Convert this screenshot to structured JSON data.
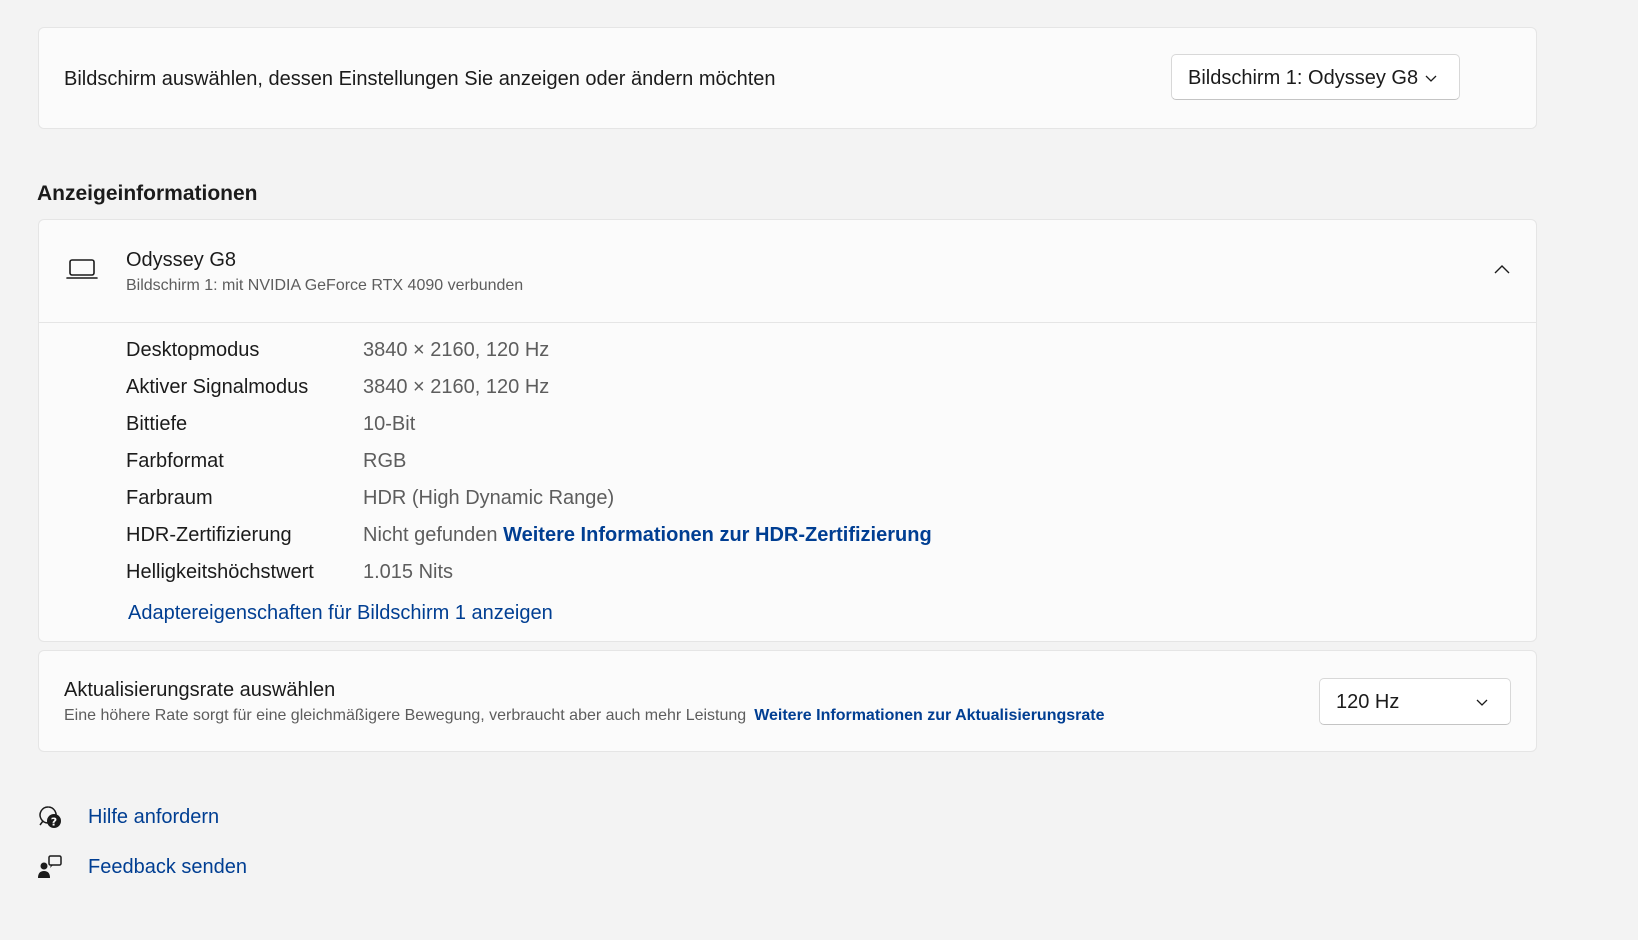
{
  "display_select": {
    "label": "Bildschirm auswählen, dessen Einstellungen Sie anzeigen oder ändern möchten",
    "selected": "Bildschirm 1: Odyssey G8"
  },
  "section_title": "Anzeigeinformationen",
  "monitor": {
    "name": "Odyssey G8",
    "subtitle": "Bildschirm 1: mit NVIDIA GeForce RTX 4090 verbunden",
    "icon": "monitor-icon",
    "rows": [
      {
        "label": "Desktopmodus",
        "value": "3840 × 2160, 120 Hz"
      },
      {
        "label": "Aktiver Signalmodus",
        "value": "3840 × 2160, 120 Hz"
      },
      {
        "label": "Bittiefe",
        "value": "10-Bit"
      },
      {
        "label": "Farbformat",
        "value": "RGB"
      },
      {
        "label": "Farbraum",
        "value": "HDR (High Dynamic Range)"
      },
      {
        "label": "HDR-Zertifizierung",
        "value": "Nicht gefunden",
        "link": "Weitere Informationen zur HDR-Zertifizierung"
      },
      {
        "label": "Helligkeitshöchstwert",
        "value": "1.015 Nits"
      }
    ],
    "adapter_link": "Adaptereigenschaften für Bildschirm 1 anzeigen"
  },
  "refresh_rate": {
    "title": "Aktualisierungsrate auswählen",
    "description": "Eine höhere Rate sorgt für eine gleichmäßigere Bewegung, verbraucht aber auch mehr Leistung",
    "link": "Weitere Informationen zur Aktualisierungsrate",
    "selected": "120 Hz"
  },
  "footer": {
    "help": "Hilfe anfordern",
    "feedback": "Feedback senden"
  },
  "colors": {
    "background": "#f3f3f3",
    "card": "#fbfbfb",
    "link": "#003e92",
    "secondary_text": "#5d5d5d"
  }
}
